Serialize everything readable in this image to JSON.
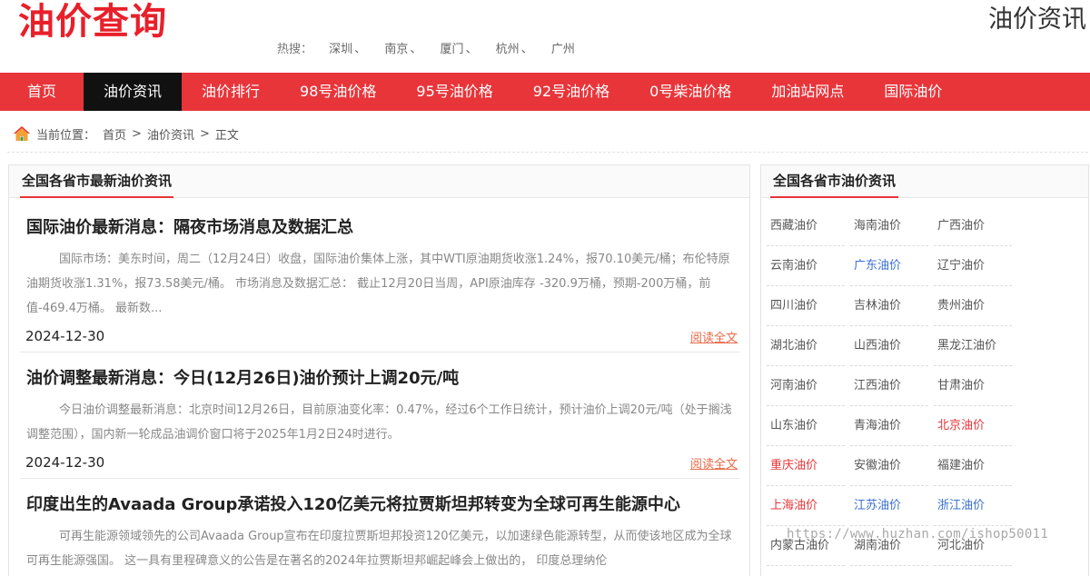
{
  "header": {
    "logo_text": "油价查询",
    "site_title": "油价资讯",
    "hot_label": "热搜：",
    "hot_cities": [
      "深圳",
      "南京",
      "厦门",
      "杭州",
      "广州"
    ],
    "hot_separator": "、"
  },
  "nav": {
    "items": [
      {
        "label": "首页"
      },
      {
        "label": "油价资讯"
      },
      {
        "label": "油价排行"
      },
      {
        "label": "98号油价格"
      },
      {
        "label": "95号油价格"
      },
      {
        "label": "92号油价格"
      },
      {
        "label": "0号柴油价格"
      },
      {
        "label": "加油站网点"
      },
      {
        "label": "国际油价"
      }
    ],
    "active_index": 1
  },
  "breadcrumb": {
    "prefix": "当前位置：",
    "items": [
      "首页",
      "油价资讯",
      "正文"
    ],
    "separator": ">"
  },
  "main": {
    "title": "全国各省市最新油价资讯",
    "read_more_label": "阅读全文",
    "articles": [
      {
        "title": "国际油价最新消息：隔夜市场消息及数据汇总",
        "summary": "国际市场：美东时间，周二（12月24日）收盘，国际油价集体上涨，其中WTI原油期货收涨1.24%，报70.10美元/桶；布伦特原油期货收涨1.31%，报73.58美元/桶。 市场消息及数据汇总： 截止12月20日当周，API原油库存 -320.9万桶，预期-200万桶，前值-469.4万桶。 最新数...",
        "date": "2024-12-30"
      },
      {
        "title": "油价调整最新消息：今日(12月26日)油价预计上调20元/吨",
        "summary": "今日油价调整最新消息：北京时间12月26日，目前原油变化率：0.47%，经过6个工作日统计，预计油价上调20元/吨（处于搁浅调整范围），国内新一轮成品油调价窗口将于2025年1月2日24时进行。",
        "date": "2024-12-30"
      },
      {
        "title": "印度出生的Avaada Group承诺投入120亿美元将拉贾斯坦邦转变为全球可再生能源中心",
        "summary": "可再生能源领域领先的公司Avaada Group宣布在印度拉贾斯坦邦投资120亿美元，以加速绿色能源转型，从而使该地区成为全球可再生能源强国。 这一具有里程碑意义的公告是在著名的2024年拉贾斯坦邦崛起峰会上做出的， 印度总理纳伦",
        "date": ""
      }
    ]
  },
  "sidebar": {
    "title": "全国各省市油价资讯",
    "cities": [
      {
        "label": "西藏油价",
        "color": "gray"
      },
      {
        "label": "海南油价",
        "color": "gray"
      },
      {
        "label": "广西油价",
        "color": "gray"
      },
      {
        "label": "云南油价",
        "color": "gray"
      },
      {
        "label": "广东油价",
        "color": "blue"
      },
      {
        "label": "辽宁油价",
        "color": "gray"
      },
      {
        "label": "四川油价",
        "color": "gray"
      },
      {
        "label": "吉林油价",
        "color": "gray"
      },
      {
        "label": "贵州油价",
        "color": "gray"
      },
      {
        "label": "湖北油价",
        "color": "gray"
      },
      {
        "label": "山西油价",
        "color": "gray"
      },
      {
        "label": "黑龙江油价",
        "color": "gray"
      },
      {
        "label": "河南油价",
        "color": "gray"
      },
      {
        "label": "江西油价",
        "color": "gray"
      },
      {
        "label": "甘肃油价",
        "color": "gray"
      },
      {
        "label": "山东油价",
        "color": "gray"
      },
      {
        "label": "青海油价",
        "color": "gray"
      },
      {
        "label": "北京油价",
        "color": "red"
      },
      {
        "label": "重庆油价",
        "color": "red"
      },
      {
        "label": "安徽油价",
        "color": "gray"
      },
      {
        "label": "福建油价",
        "color": "gray"
      },
      {
        "label": "上海油价",
        "color": "red"
      },
      {
        "label": "江苏油价",
        "color": "blue"
      },
      {
        "label": "浙江油价",
        "color": "blue"
      },
      {
        "label": "内蒙古油价",
        "color": "gray"
      },
      {
        "label": "湖南油价",
        "color": "gray"
      },
      {
        "label": "河北油价",
        "color": "gray"
      }
    ]
  },
  "colors": {
    "brand_red": "#e8353a",
    "nav_active": "#111111",
    "link_blue": "#3a6fd0",
    "read_more": "#e86a4a"
  },
  "watermark": "https://www.huzhan.com/ishop50011"
}
